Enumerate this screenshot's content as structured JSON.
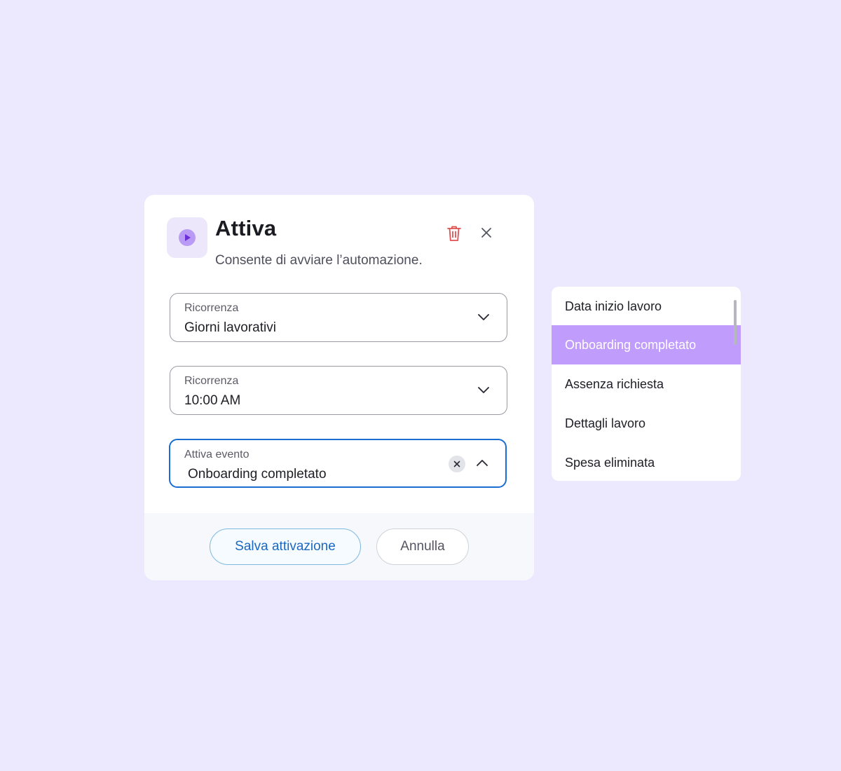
{
  "dialog": {
    "title": "Attiva",
    "subtitle": "Consente di avviare l’automazione.",
    "header_icon": "play-icon",
    "delete_icon": "trash-icon",
    "close_icon": "close-icon",
    "fields": [
      {
        "label": "Ricorrenza",
        "value": "Giorni lavorativi",
        "icon": "chevron-down-icon"
      },
      {
        "label": "Ricorrenza",
        "value": "10:00 AM",
        "icon": "chevron-down-icon"
      },
      {
        "label": "Attiva evento",
        "value": "Onboarding completato",
        "icon": "chevron-up-icon",
        "clear_icon": "clear-icon"
      }
    ],
    "footer": {
      "save_label": "Salva attivazione",
      "cancel_label": "Annulla"
    }
  },
  "dropdown": {
    "items": [
      {
        "label": "Data inizio lavoro",
        "selected": false
      },
      {
        "label": "Onboarding completato",
        "selected": true
      },
      {
        "label": "Assenza richiesta",
        "selected": false
      },
      {
        "label": "Dettagli lavoro",
        "selected": false
      },
      {
        "label": "Spesa eliminata",
        "selected": false
      }
    ]
  },
  "colors": {
    "background": "#ece8fd",
    "accent_purple": "#c09cfd",
    "active_border": "#1a6dd1",
    "delete_red": "#e05252",
    "play_icon": "#7b3fe4"
  }
}
